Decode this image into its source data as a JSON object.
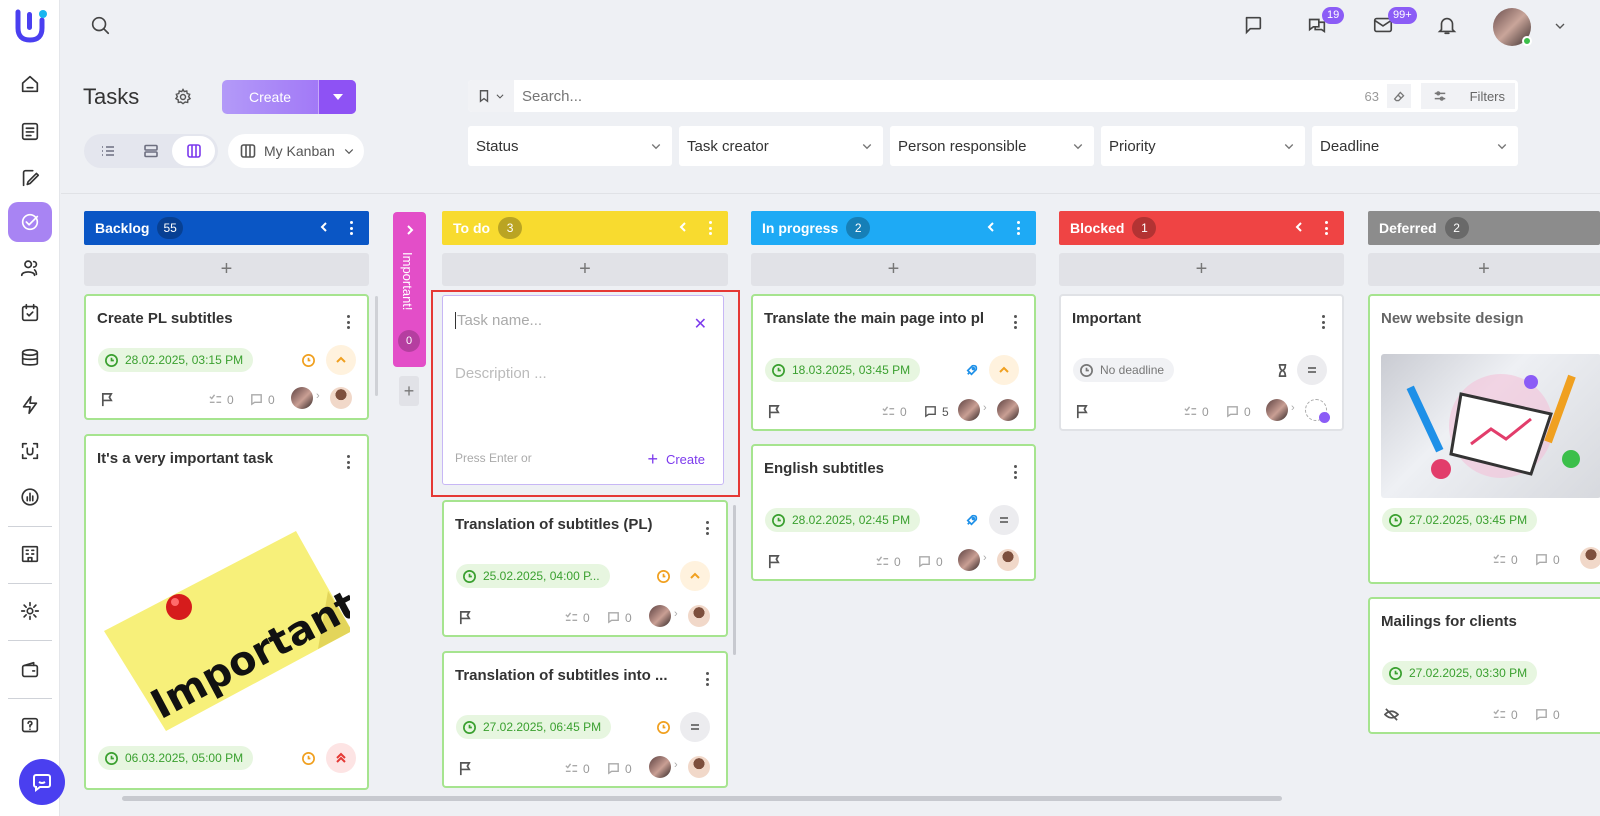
{
  "header": {
    "title": "Tasks",
    "create_label": "Create",
    "kanban_label": "My Kanban",
    "search_placeholder": "Search...",
    "result_count": "63",
    "filters_label": "Filters"
  },
  "topbar": {
    "chats_badge": "19",
    "mail_badge": "99+"
  },
  "filter_selects": [
    "Status",
    "Task creator",
    "Person responsible",
    "Priority",
    "Deadline"
  ],
  "colors": {
    "backlog": "#0a56c5",
    "important": "#e34ec8",
    "todo": "#f8db2f",
    "in_progress": "#1eaaf5",
    "blocked": "#ef4444",
    "deferred": "#8c8c8c",
    "accent": "#8b5cf6"
  },
  "columns": {
    "backlog": {
      "name": "Backlog",
      "count": "55",
      "cards": [
        {
          "title": "Create PL subtitles",
          "date": "28.02.2025, 03:15 PM",
          "checks": "0",
          "comments": "0"
        },
        {
          "title": "It's a very important task",
          "date": "06.03.2025, 05:00 PM",
          "sticker": "Important"
        }
      ]
    },
    "important": {
      "name": "Important!",
      "count": "0"
    },
    "todo": {
      "name": "To do",
      "count": "3",
      "new_task": {
        "name_placeholder": "Task name...",
        "desc_placeholder": "Description ...",
        "hint": "Press Enter or",
        "create": "Create"
      },
      "cards": [
        {
          "title": "Translation of subtitles (PL)",
          "date": "25.02.2025, 04:00 P...",
          "checks": "0",
          "comments": "0"
        },
        {
          "title": "Translation of subtitles into ...",
          "date": "27.02.2025, 06:45 PM",
          "checks": "0",
          "comments": "0"
        }
      ]
    },
    "in_progress": {
      "name": "In progress",
      "count": "2",
      "cards": [
        {
          "title": "Translate the main page into pl",
          "date": "18.03.2025, 03:45 PM",
          "checks": "0",
          "comments": "5"
        },
        {
          "title": "English subtitles",
          "date": "28.02.2025, 02:45 PM",
          "checks": "0",
          "comments": "0"
        }
      ]
    },
    "blocked": {
      "name": "Blocked",
      "count": "1",
      "cards": [
        {
          "title": "Important",
          "date": "No deadline",
          "checks": "0",
          "comments": "0"
        }
      ]
    },
    "deferred": {
      "name": "Deferred",
      "count": "2",
      "cards": [
        {
          "title": "New website design",
          "date": "27.02.2025, 03:45 PM",
          "checks": "0",
          "comments": "0"
        },
        {
          "title": "Mailings for clients",
          "date": "27.02.2025, 03:30 PM",
          "checks": "0",
          "comments": "0"
        }
      ]
    }
  }
}
